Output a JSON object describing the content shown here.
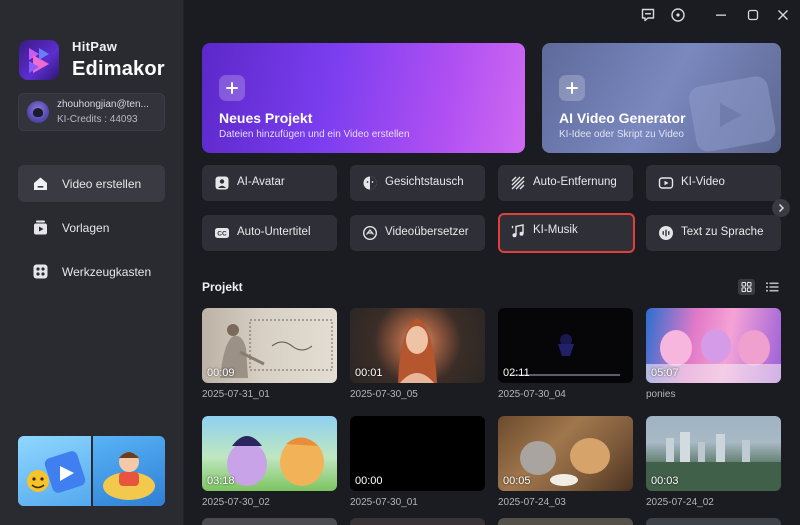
{
  "brand": {
    "top": "HitPaw",
    "main": "Edimakor"
  },
  "account": {
    "email": "zhouhongjian@ten...",
    "credits": "KI-Credits : 44093"
  },
  "nav": [
    {
      "label": "Video erstellen",
      "icon": "home-icon",
      "active": true
    },
    {
      "label": "Vorlagen",
      "icon": "templates-icon",
      "active": false
    },
    {
      "label": "Werkzeugkasten",
      "icon": "toolbox-icon",
      "active": false
    }
  ],
  "titlebar": {
    "icons": [
      "feedback-icon",
      "info-icon",
      "minimize-icon",
      "maximize-icon",
      "close-icon"
    ]
  },
  "hero": [
    {
      "title": "Neues Projekt",
      "subtitle": "Dateien hinzufügen und ein Video erstellen"
    },
    {
      "title": "AI Video Generator",
      "subtitle": "KI-Idee oder Skript zu Video"
    }
  ],
  "tools": [
    {
      "label": "AI-Avatar",
      "icon": "avatar-icon",
      "selected": false
    },
    {
      "label": "Gesichtstausch",
      "icon": "face-swap-icon",
      "selected": false
    },
    {
      "label": "Auto-Entfernung",
      "icon": "auto-remove-icon",
      "selected": false
    },
    {
      "label": "KI-Video",
      "icon": "ai-video-icon",
      "selected": false
    },
    {
      "label": "Auto-Untertitel",
      "icon": "cc-icon",
      "selected": false
    },
    {
      "label": "Videoübersetzer",
      "icon": "translate-icon",
      "selected": false
    },
    {
      "label": "KI-Musik",
      "icon": "music-icon",
      "selected": true
    },
    {
      "label": "Text zu Sprache",
      "icon": "tts-icon",
      "selected": false
    }
  ],
  "projects": {
    "title": "Projekt",
    "items": [
      {
        "name": "2025-07-31_01",
        "duration": "00:09"
      },
      {
        "name": "2025-07-30_05",
        "duration": "00:01"
      },
      {
        "name": "2025-07-30_04",
        "duration": "02:11"
      },
      {
        "name": "ponies",
        "duration": "05:07"
      },
      {
        "name": "2025-07-30_02",
        "duration": "03:18"
      },
      {
        "name": "2025-07-30_01",
        "duration": "00:00"
      },
      {
        "name": "2025-07-24_03",
        "duration": "00:05"
      },
      {
        "name": "2025-07-24_02",
        "duration": "00:03"
      }
    ]
  },
  "colors": {
    "accent": "#7c3ef0",
    "selection": "#e0403a",
    "sidebar": "#2a2b31",
    "background": "#1b1c21"
  }
}
